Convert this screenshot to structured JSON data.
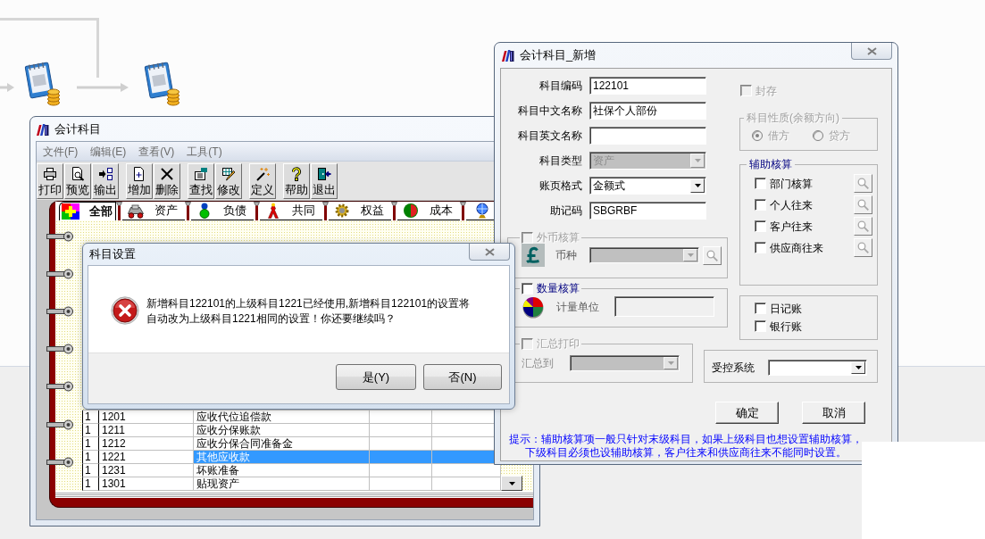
{
  "main_window": {
    "title": "会计科目",
    "menu": [
      "文件(F)",
      "编辑(E)",
      "查看(V)",
      "工具(T)"
    ],
    "toolbar_groups": [
      [
        "打印",
        "预览",
        "输出"
      ],
      [
        "增加",
        "删除"
      ],
      [
        "查找",
        "修改"
      ],
      [
        "定义"
      ],
      [
        "帮助",
        "退出"
      ]
    ],
    "tabs": [
      {
        "label": "全部",
        "selected": true
      },
      {
        "label": "资产",
        "selected": false
      },
      {
        "label": "负债",
        "selected": false
      },
      {
        "label": "共同",
        "selected": false
      },
      {
        "label": "权益",
        "selected": false
      },
      {
        "label": "成本",
        "selected": false
      },
      {
        "selected": false
      }
    ],
    "table": {
      "rows": [
        {
          "level": "1",
          "code": "1201",
          "name": "应收代位追偿款",
          "selected": false
        },
        {
          "level": "1",
          "code": "1211",
          "name": "应收分保账款",
          "selected": false
        },
        {
          "level": "1",
          "code": "1212",
          "name": "应收分保合同准备金",
          "selected": false
        },
        {
          "level": "1",
          "code": "1221",
          "name": "其他应收款",
          "selected": true
        },
        {
          "level": "1",
          "code": "1231",
          "name": "坏账准备",
          "selected": false
        },
        {
          "level": "1",
          "code": "1301",
          "name": "贴现资产",
          "selected": false
        }
      ]
    }
  },
  "message_dialog": {
    "title": "科目设置",
    "message_lines": [
      "新增科目122101的上级科目1221已经使用,新增科目122101的设置将",
      "自动改为上级科目1221相同的设置！你还要继续吗？"
    ],
    "buttons": [
      "是(Y)",
      "否(N)"
    ]
  },
  "account_dialog": {
    "title": "会计科目_新增",
    "fields": [
      {
        "kind": "input",
        "label": "科目编码",
        "value": "122101",
        "disabled": false
      },
      {
        "kind": "input",
        "label": "科目中文名称",
        "value": "社保个人部份",
        "disabled": false
      },
      {
        "kind": "input",
        "label": "科目英文名称",
        "disabled": false
      },
      {
        "kind": "select",
        "label": "科目类型",
        "value": "资产",
        "disabled": true
      },
      {
        "kind": "select",
        "label": "账页格式",
        "value": "金额式",
        "disabled": false
      },
      {
        "kind": "input",
        "label": "助记码",
        "value": "SBGRBF",
        "disabled": false
      }
    ],
    "sealed": {
      "label": "封存",
      "checked": false,
      "disabled": true
    },
    "balance_direction": {
      "label": "科目性质(余额方向)",
      "disabled": true,
      "options": [
        {
          "label": "借方",
          "selected": true
        },
        {
          "label": "贷方",
          "selected": false
        }
      ]
    },
    "auxiliary": {
      "label": "辅助核算",
      "items": [
        {
          "label": "部门核算",
          "checked": false
        },
        {
          "label": "个人往来",
          "checked": false
        },
        {
          "label": "客户往来",
          "checked": false
        },
        {
          "label": "供应商往来",
          "checked": false
        }
      ]
    },
    "foreign_currency": {
      "label": "外币核算",
      "checked": false,
      "disabled": true,
      "currency_label": "币种"
    },
    "quantity": {
      "label": "数量核算",
      "checked": false,
      "disabled": false,
      "unit_label": "计量单位"
    },
    "ledgers": [
      {
        "label": "日记账",
        "checked": false
      },
      {
        "label": "银行账",
        "checked": false
      }
    ],
    "summary_print": {
      "label": "汇总打印",
      "checked": false,
      "disabled": true,
      "target_label": "汇总到"
    },
    "controlled_system": {
      "label": "受控系统"
    },
    "buttons": [
      "确定",
      "取消"
    ],
    "hint_lines": [
      "提示：辅助核算项一般只针对末级科目，如果上级科目也想设置辅助核算，",
      "下级科目必须也设辅助核算，客户往来和供应商往来不能同时设置。"
    ]
  }
}
